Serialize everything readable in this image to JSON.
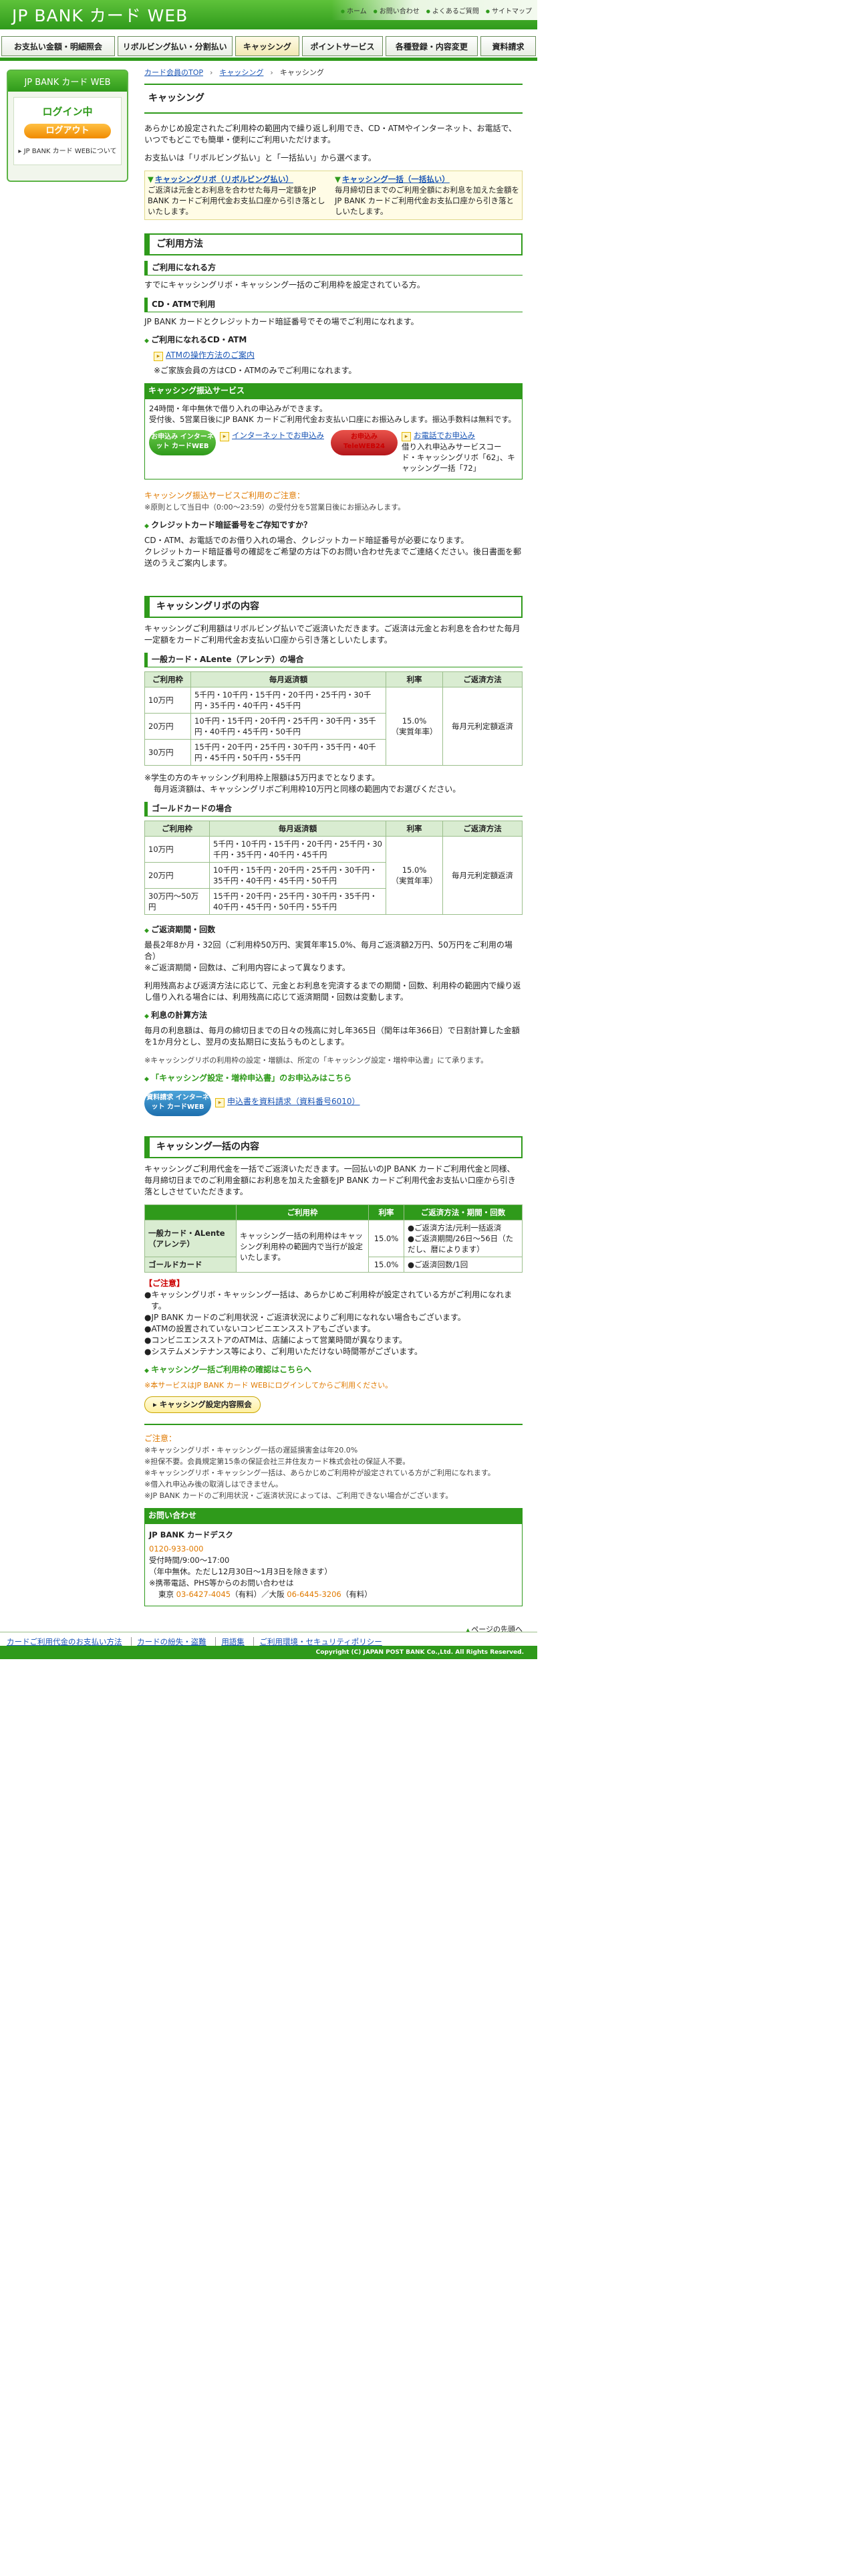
{
  "header": {
    "logo": "JP BANK カード WEB",
    "top_links": [
      "ホーム",
      "お問い合わせ",
      "よくあるご質問",
      "サイトマップ"
    ]
  },
  "gnav": [
    "お支払い金額・明細照会",
    "リボルビング払い・分割払い",
    "キャッシング",
    "ポイントサービス",
    "各種登録・内容変更",
    "資料請求"
  ],
  "sidebar": {
    "title": "JP BANK カード WEB",
    "status": "ログイン中",
    "logout": "ログアウト",
    "about": "JP BANK カード WEBについて"
  },
  "breadcrumb": [
    "カード会員のTOP",
    "キャッシング",
    "キャッシング"
  ],
  "page_title": "キャッシング",
  "intro": {
    "p1": "あらかじめ設定されたご利用枠の範囲内で繰り返し利用でき、CD・ATMやインターネット、お電話で、いつでもどこでも簡単・便利にご利用いただけます。",
    "p2": "お支払いは「リボルビング払い」と「一括払い」から選べます。"
  },
  "two_box": {
    "revo_title": "キャッシングリボ（リボルビング払い）",
    "revo_text": "ご返済は元金とお利息を合わせた毎月一定額をJP BANK カードご利用代金お支払口座から引き落としいたします。",
    "lump_title": "キャッシング一括（一括払い）",
    "lump_text": "毎月締切日までのご利用全額にお利息を加えた金額をJP BANK カードご利用代金お支払口座から引き落としいたします。"
  },
  "usage": {
    "title": "ご利用方法",
    "sub1": "ご利用になれる方",
    "sub1_text": "すでにキャッシングリボ・キャッシング一括のご利用枠を設定されている方。",
    "sub2": "CD・ATMで利用",
    "sub2_text": "JP BANK カードとクレジットカード暗証番号でその場でご利用になれます。",
    "atm_title": "ご利用になれるCD・ATM",
    "atm_link": "ATMの操作方法のご案内",
    "atm_note": "※ご家族会員の方はCD・ATMのみでご利用になれます。",
    "transfer_head": "キャッシング振込サービス",
    "transfer_text1": "24時間・年中無休で借り入れの申込みができます。",
    "transfer_text2": "受付後、5営業日後にJP BANK カードご利用代金お支払い口座にお振込みします。振込手数料は無料です。",
    "badge_web": "お申込み インターネット カードWEB",
    "web_link": "インターネットでお申込み",
    "badge_phone": "お申込み TeleWEB24",
    "phone_link": "お電話でお申込み",
    "phone_text": "借り入れ申込みサービスコード・キャッシングリボ「62」、キャッシング一括「72」",
    "caution_title": "キャッシング振込サービスご利用のご注意：",
    "caution_text": "※原則として当日中（0:00〜23:59）の受付分を5営業日後にお振込みします。",
    "pin_title": "クレジットカード暗証番号をご存知ですか？",
    "pin_text1": "CD・ATM、お電話でのお借り入れの場合、クレジットカード暗証番号が必要になります。",
    "pin_text2": "クレジットカード暗証番号の確認をご希望の方は下のお問い合わせ先までご連絡ください。後日書面を郵送のうえご案内します。"
  },
  "revo": {
    "title": "キャッシングリボの内容",
    "intro": "キャッシングご利用額はリボルビング払いでご返済いただきます。ご返済は元金とお利息を合わせた毎月一定額をカードご利用代金お支払い口座から引き落としいたします。",
    "general_title": "一般カード・ALente（アレンテ）の場合",
    "headers": [
      "ご利用枠",
      "毎月返済額",
      "利率",
      "ご返済方法"
    ],
    "general_rows": [
      {
        "limit": "10万円",
        "amount": "5千円・10千円・15千円・20千円・25千円・30千円・35千円・40千円・45千円"
      },
      {
        "limit": "20万円",
        "amount": "10千円・15千円・20千円・25千円・30千円・35千円・40千円・45千円・50千円"
      },
      {
        "limit": "30万円",
        "amount": "15千円・20千円・25千円・30千円・35千円・40千円・45千円・50千円・55千円"
      }
    ],
    "rate": "15.0%",
    "rate_note": "（実質年率）",
    "method": "毎月元利定額返済",
    "student_note1": "※学生の方のキャッシング利用枠上限額は5万円までとなります。",
    "student_note2": "毎月返済額は、キャッシングリボご利用枠10万円と同様の範囲内でお選びください。",
    "gold_title": "ゴールドカードの場合",
    "gold_rows": [
      {
        "limit": "10万円",
        "amount": "5千円・10千円・15千円・20千円・25千円・30千円・35千円・40千円・45千円"
      },
      {
        "limit": "20万円",
        "amount": "10千円・15千円・20千円・25千円・30千円・35千円・40千円・45千円・50千円"
      },
      {
        "limit": "30万円〜50万円",
        "amount": "15千円・20千円・25千円・30千円・35千円・40千円・45千円・50千円・55千円"
      }
    ],
    "period_title": "ご返済期間・回数",
    "period_text1": "最長2年8か月・32回（ご利用枠50万円、実質年率15.0%、毎月ご返済額2万円、50万円をご利用の場合）",
    "period_text2": "※ご返済期間・回数は、ご利用内容によって異なります。",
    "period_text3": "利用残高および返済方法に応じて、元金とお利息を完済するまでの期間・回数、利用枠の範囲内で繰り返し借り入れる場合には、利用残高に応じて返済期間・回数は変動します。",
    "interest_title": "利息の計算方法",
    "interest_text": "毎月の利息額は、毎月の締切日までの日々の残高に対し年365日（閏年は年366日）で日割計算した金額を1か月分とし、翌月の支払期日に支払うものとします。",
    "interest_note": "※キャッシングリボの利用枠の設定・増額は、所定の「キャッシング設定・増枠申込書」にて承ります。",
    "apply_title": "「キャッシング設定・増枠申込書」のお申込みはこちら",
    "badge_doc": "資料請求 インターネット カードWEB",
    "apply_link": "申込書を資料請求（資料番号6010）"
  },
  "lump": {
    "title": "キャッシング一括の内容",
    "intro": "キャッシングご利用代金を一括でご返済いただきます。一回払いのJP BANK カードご利用代金と同様、毎月締切日までのご利用金額にお利息を加えた金額をJP BANK カードご利用代金お支払い口座から引き落としさせていただきます。",
    "headers": [
      "ご利用枠",
      "利率",
      "ご返済方法・期間・回数"
    ],
    "row1_label": "一般カード・ALente（アレンテ）",
    "row2_label": "ゴールドカード",
    "limit_text": "キャッシング一括の利用枠はキャッシング利用枠の範囲内で当行が設定いたします。",
    "rate1": "15.0%",
    "rate2": "15.0%",
    "method1": [
      "ご返済方法/元利一括返済",
      "ご返済期間/26日〜56日（ただし、暦によります）"
    ],
    "method2": "ご返済回数/1回",
    "caution_title": "【ご注意】",
    "cautions": [
      "キャッシングリボ・キャッシング一括は、あらかじめご利用枠が設定されている方がご利用になれます。",
      "JP BANK カードのご利用状況・ご返済状況によりご利用になれない場合もございます。",
      "ATMの設置されていないコンビニエンスストアもございます。",
      "コンビニエンスストアのATMは、店舗によって営業時間が異なります。",
      "システムメンテナンス等により、ご利用いただけない時間帯がございます。"
    ],
    "check_title": "キャッシング一括ご利用枠の確認はこちらへ",
    "check_note": "※本サービスはJP BANK カード WEBにログインしてからご利用ください。",
    "check_button": "キャッシング設定内容照会"
  },
  "notes": {
    "title": "ご注意：",
    "items": [
      "※キャッシングリボ・キャッシング一括の遅延損害金は年20.0%",
      "※担保不要。会員規定第15条の保証会社三井住友カード株式会社の保証人不要。",
      "※キャッシングリボ・キャッシング一括は、あらかじめご利用枠が設定されている方がご利用になれます。",
      "※借入れ申込み後の取消しはできません。",
      "※JP BANK カードのご利用状況・ご返済状況によっては、ご利用できない場合がございます。"
    ]
  },
  "inquiry": {
    "head": "お問い合わせ",
    "desk": "JP BANK カードデスク",
    "free": "0120-933-000",
    "hours": "受付時間/9:00〜17:00",
    "hours_note": "（年中無休。ただし12月30日〜1月3日を除きます）",
    "mobile": "※携帯電話、PHS等からのお問い合わせは",
    "tokyo_label": "東京",
    "tokyo": "03-6427-4045",
    "osaka_label": "（有料）／大阪",
    "osaka": "06-6445-3206",
    "paid": "（有料）"
  },
  "to_top": "ページの先頭へ",
  "footer": {
    "links": [
      "カードご利用代金のお支払い方法",
      "カードの紛失・盗難",
      "用語集",
      "ご利用環境・セキュリティポリシー"
    ],
    "copyright": "Copyright (C) JAPAN POST BANK Co.,Ltd. All Rights Reserved."
  }
}
